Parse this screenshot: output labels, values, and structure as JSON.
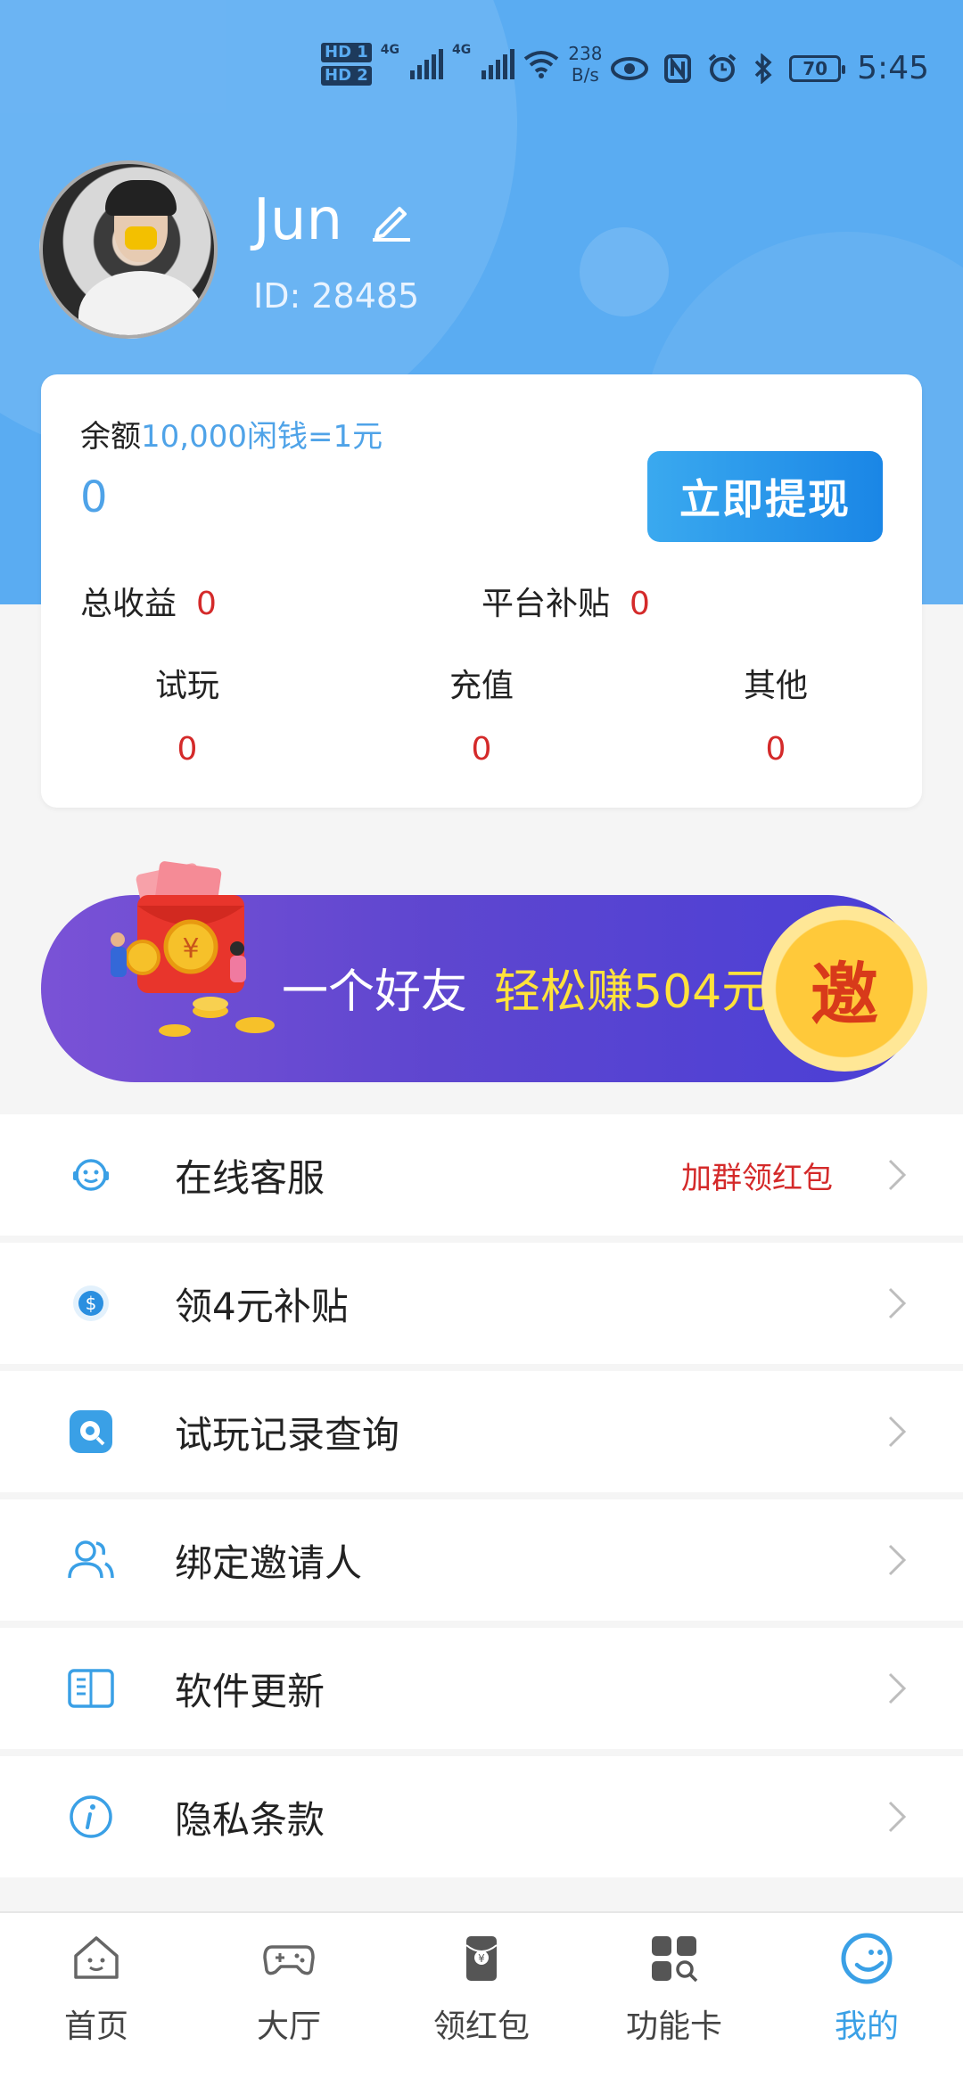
{
  "status_bar": {
    "hd1": "HD 1",
    "hd2": "HD 2",
    "net1": "4G",
    "net2": "4G",
    "speed_value": "238",
    "speed_unit": "B/s",
    "battery": "70",
    "time": "5:45"
  },
  "profile": {
    "name": "Jun",
    "id_text": "ID:  28485"
  },
  "balance_card": {
    "balance_label": "余额",
    "rate_text": "10,000闲钱=1元",
    "balance_value": "0",
    "withdraw_label": "立即提现",
    "total_label": "总收益",
    "total_value": "0",
    "subsidy_label": "平台补贴",
    "subsidy_value": "0",
    "columns": [
      {
        "label": "试玩",
        "value": "0"
      },
      {
        "label": "充值",
        "value": "0"
      },
      {
        "label": "其他",
        "value": "0"
      }
    ]
  },
  "banner": {
    "text": "一个好友",
    "highlight": "轻松赚504元",
    "badge": "邀"
  },
  "menu": [
    {
      "label": "在线客服",
      "tip": "加群领红包",
      "icon": "service-face-icon"
    },
    {
      "label": "领4元补贴",
      "icon": "coin-subsidy-icon"
    },
    {
      "label": "试玩记录查询",
      "icon": "record-search-icon"
    },
    {
      "label": "绑定邀请人",
      "icon": "users-icon"
    },
    {
      "label": "软件更新",
      "icon": "book-update-icon"
    },
    {
      "label": "隐私条款",
      "icon": "info-icon"
    }
  ],
  "tabbar": [
    {
      "label": "首页",
      "icon": "home-icon"
    },
    {
      "label": "大厅",
      "icon": "gamepad-icon"
    },
    {
      "label": "领红包",
      "icon": "red-packet-icon"
    },
    {
      "label": "功能卡",
      "icon": "grid-search-icon"
    },
    {
      "label": "我的",
      "icon": "smile-icon",
      "active": true
    }
  ],
  "colors": {
    "header": "#5aacf2",
    "accent": "#3aa0e6",
    "red": "#d42a2a",
    "banner_highlight": "#ffe23b"
  }
}
